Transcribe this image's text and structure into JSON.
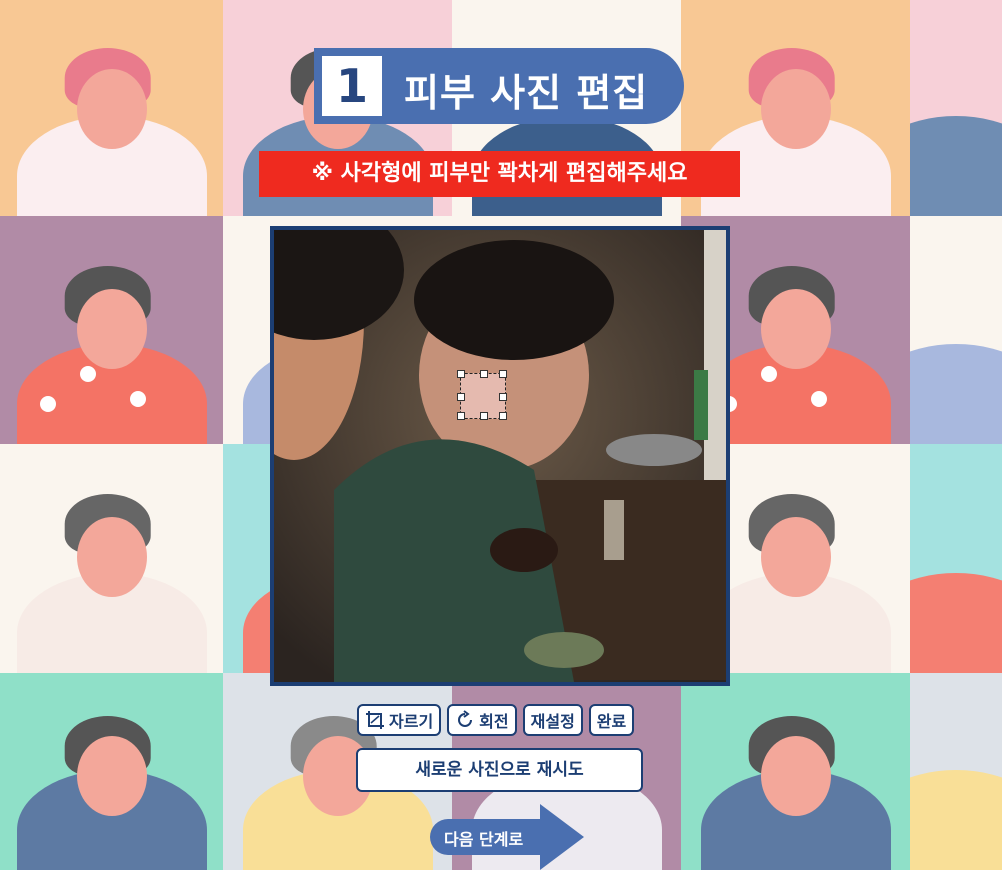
{
  "title": {
    "step_number": "1",
    "text": "피부 사진 편집"
  },
  "notice": "※ 사각형에 피부만 꽉차게 편집해주세요",
  "toolbar": {
    "crop_label": "자르기",
    "rotate_label": "회전",
    "reset_label": "재설정",
    "done_label": "완료"
  },
  "retry_label": "새로운 사진으로 재시도",
  "next_label": "다음 단계로",
  "icons": {
    "crop": "crop-icon",
    "rotate": "rotate-icon",
    "next": "arrow-right-icon"
  },
  "colors": {
    "primary": "#4a6fb0",
    "dark": "#1c3e73",
    "notice": "#ef2a1f"
  }
}
